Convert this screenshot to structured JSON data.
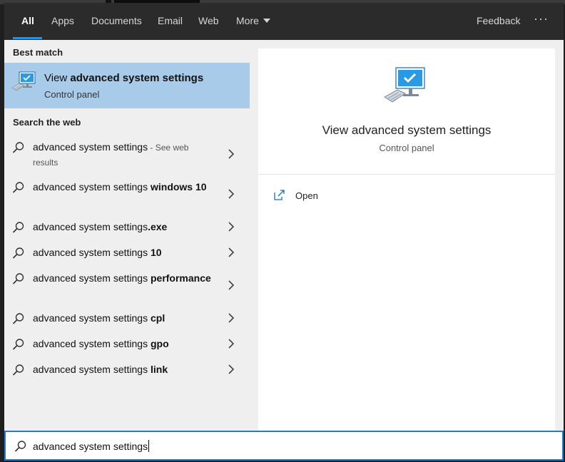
{
  "tabs": [
    {
      "label": "All",
      "active": true
    },
    {
      "label": "Apps"
    },
    {
      "label": "Documents"
    },
    {
      "label": "Email"
    },
    {
      "label": "Web"
    },
    {
      "label": "More"
    }
  ],
  "feedback_label": "Feedback",
  "more_options_label": "···",
  "best_match": {
    "section_label": "Best match",
    "title_prefix": "View ",
    "title_bold": "advanced system settings",
    "subtitle": "Control panel",
    "icon": "computer-settings-icon",
    "highlight_color": "#a9cbea"
  },
  "web": {
    "section_label": "Search the web",
    "results": [
      {
        "text": "advanced system settings",
        "bold": "",
        "note": " - See web results"
      },
      {
        "text": "advanced system settings ",
        "bold": "windows 10",
        "note": ""
      },
      {
        "text": "advanced system settings",
        "bold": ".exe",
        "note": ""
      },
      {
        "text": "advanced system settings ",
        "bold": "10",
        "note": ""
      },
      {
        "text": "advanced system settings ",
        "bold": "performance",
        "note": ""
      },
      {
        "text": "advanced system settings ",
        "bold": "cpl",
        "note": ""
      },
      {
        "text": "advanced system settings ",
        "bold": "gpo",
        "note": ""
      },
      {
        "text": "advanced system settings ",
        "bold": "link",
        "note": ""
      }
    ]
  },
  "preview": {
    "title": "View advanced system settings",
    "subtitle": "Control panel",
    "open_label": "Open"
  },
  "search": {
    "value": "advanced system settings"
  },
  "colors": {
    "accent": "#1a7fd4",
    "header_bg": "#2b2b2b"
  }
}
